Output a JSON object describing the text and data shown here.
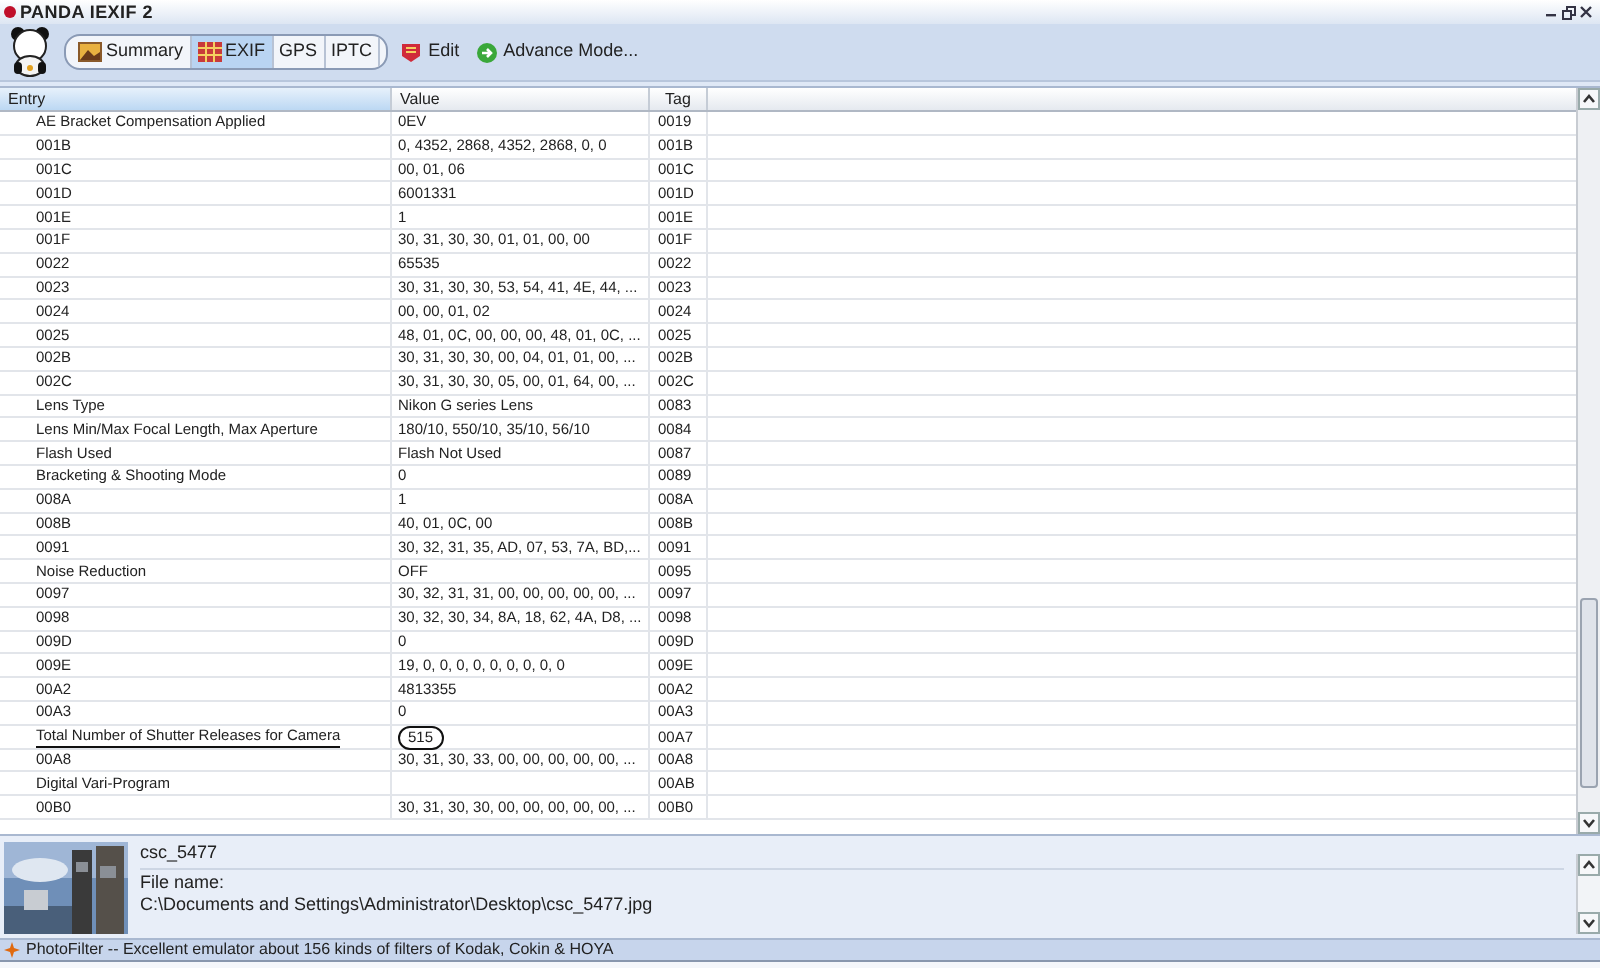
{
  "window": {
    "title": "PANDA IEXIF 2"
  },
  "tabs": [
    {
      "label": "Summary",
      "selected": false
    },
    {
      "label": "EXIF",
      "selected": true
    },
    {
      "label": "GPS",
      "selected": false
    },
    {
      "label": "IPTC",
      "selected": false
    }
  ],
  "toolbar": [
    {
      "label": "Edit",
      "kind": "edit"
    },
    {
      "label": "Advance Mode...",
      "kind": "advance"
    }
  ],
  "table": {
    "columns": [
      "Entry",
      "Value",
      "Tag"
    ],
    "rows": [
      {
        "entry": "AE Bracket Compensation Applied",
        "value": "0EV",
        "tag": "0019",
        "marked": false
      },
      {
        "entry": "001B",
        "value": "0, 4352, 2868, 4352, 2868, 0, 0",
        "tag": "001B",
        "marked": false
      },
      {
        "entry": "001C",
        "value": "00, 01, 06",
        "tag": "001C",
        "marked": false
      },
      {
        "entry": "001D",
        "value": "6001331",
        "tag": "001D",
        "marked": false
      },
      {
        "entry": "001E",
        "value": "1",
        "tag": "001E",
        "marked": false
      },
      {
        "entry": "001F",
        "value": "30, 31, 30, 30, 01, 01, 00, 00",
        "tag": "001F",
        "marked": false
      },
      {
        "entry": "0022",
        "value": "65535",
        "tag": "0022",
        "marked": false
      },
      {
        "entry": "0023",
        "value": "30, 31, 30, 30, 53, 54, 41, 4E, 44, ...",
        "tag": "0023",
        "marked": false
      },
      {
        "entry": "0024",
        "value": "00, 00, 01, 02",
        "tag": "0024",
        "marked": false
      },
      {
        "entry": "0025",
        "value": "48, 01, 0C, 00, 00, 00, 48, 01, 0C, ...",
        "tag": "0025",
        "marked": false
      },
      {
        "entry": "002B",
        "value": "30, 31, 30, 30, 00, 04, 01, 01, 00, ...",
        "tag": "002B",
        "marked": false
      },
      {
        "entry": "002C",
        "value": "30, 31, 30, 30, 05, 00, 01, 64, 00, ...",
        "tag": "002C",
        "marked": false
      },
      {
        "entry": "Lens Type",
        "value": "Nikon G series Lens",
        "tag": "0083",
        "marked": false
      },
      {
        "entry": "Lens Min/Max Focal Length, Max Aperture",
        "value": "180/10, 550/10, 35/10, 56/10",
        "tag": "0084",
        "marked": false
      },
      {
        "entry": "Flash Used",
        "value": "Flash Not Used",
        "tag": "0087",
        "marked": false
      },
      {
        "entry": "Bracketing & Shooting Mode",
        "value": "0",
        "tag": "0089",
        "marked": false
      },
      {
        "entry": "008A",
        "value": "1",
        "tag": "008A",
        "marked": false
      },
      {
        "entry": "008B",
        "value": "40, 01, 0C, 00",
        "tag": "008B",
        "marked": false
      },
      {
        "entry": "0091",
        "value": "30, 32, 31, 35, AD, 07, 53, 7A, BD,...",
        "tag": "0091",
        "marked": false
      },
      {
        "entry": "Noise Reduction",
        "value": "OFF",
        "tag": "0095",
        "marked": false
      },
      {
        "entry": "0097",
        "value": "30, 32, 31, 31, 00, 00, 00, 00, 00, ...",
        "tag": "0097",
        "marked": false
      },
      {
        "entry": "0098",
        "value": "30, 32, 30, 34, 8A, 18, 62, 4A, D8, ...",
        "tag": "0098",
        "marked": false
      },
      {
        "entry": "009D",
        "value": "0",
        "tag": "009D",
        "marked": false
      },
      {
        "entry": "009E",
        "value": "19, 0, 0, 0, 0, 0, 0, 0, 0, 0",
        "tag": "009E",
        "marked": false
      },
      {
        "entry": "00A2",
        "value": "4813355",
        "tag": "00A2",
        "marked": false
      },
      {
        "entry": "00A3",
        "value": "0",
        "tag": "00A3",
        "marked": false
      },
      {
        "entry": "Total Number of Shutter Releases for Camera",
        "value": "515",
        "tag": "00A7",
        "marked": true
      },
      {
        "entry": "00A8",
        "value": "30, 31, 30, 33, 00, 00, 00, 00, 00, ...",
        "tag": "00A8",
        "marked": false
      },
      {
        "entry": "Digital Vari-Program",
        "value": "",
        "tag": "00AB",
        "marked": false
      },
      {
        "entry": "00B0",
        "value": "30, 31, 30, 30, 00, 00, 00, 00, 00, ...",
        "tag": "00B0",
        "marked": false
      }
    ]
  },
  "file_panel": {
    "name": "csc_5477",
    "label": "File name:",
    "path": "C:\\Documents and Settings\\Administrator\\Desktop\\csc_5477.jpg"
  },
  "status_bar": "PhotoFilter -- Excellent emulator about 156 kinds of filters of Kodak, Cokin & HOYA"
}
